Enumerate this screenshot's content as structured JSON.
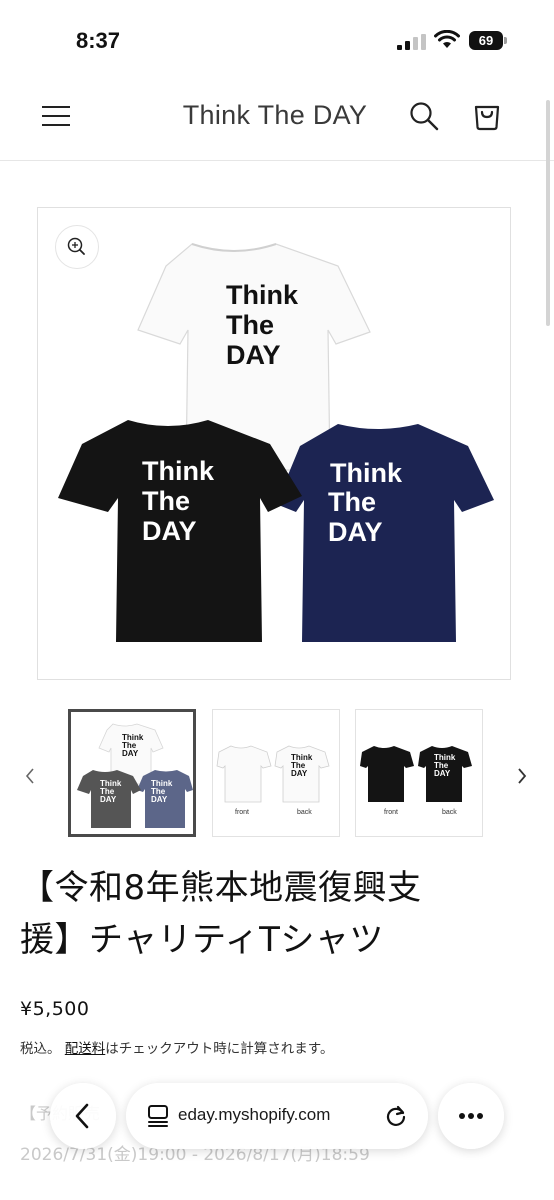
{
  "status_bar": {
    "time": "8:37",
    "battery": "69"
  },
  "header": {
    "site_title": "Think The DAY"
  },
  "product": {
    "shirt_print": [
      "Think",
      "The",
      "DAY"
    ],
    "thumbnails": [
      {
        "colors": [
          "white",
          "charcoal",
          "slate blue"
        ],
        "labels": []
      },
      {
        "colors": [
          "white"
        ],
        "labels": [
          "front",
          "back"
        ]
      },
      {
        "colors": [
          "black"
        ],
        "labels": [
          "front",
          "back"
        ]
      }
    ],
    "title_line1": "【令和8年熊本地震復興支",
    "title_line2": "援】チャリティTシャツ",
    "price": "¥5,500",
    "tax_included": "税込。",
    "shipping_link": "配送料",
    "tax_rest": "はチェックアウト時に計算されます。",
    "faded_line1": "【予約販売",
    "faded_line2": "2026/7/31(金)19:00 - 2026/8/17(月)18:59"
  },
  "browser": {
    "url": "eday.myshopify.com"
  },
  "colors": {
    "white_shirt": "#fafafa",
    "black_shirt": "#141414",
    "navy_shirt": "#1c2452",
    "accent": "#121212"
  }
}
